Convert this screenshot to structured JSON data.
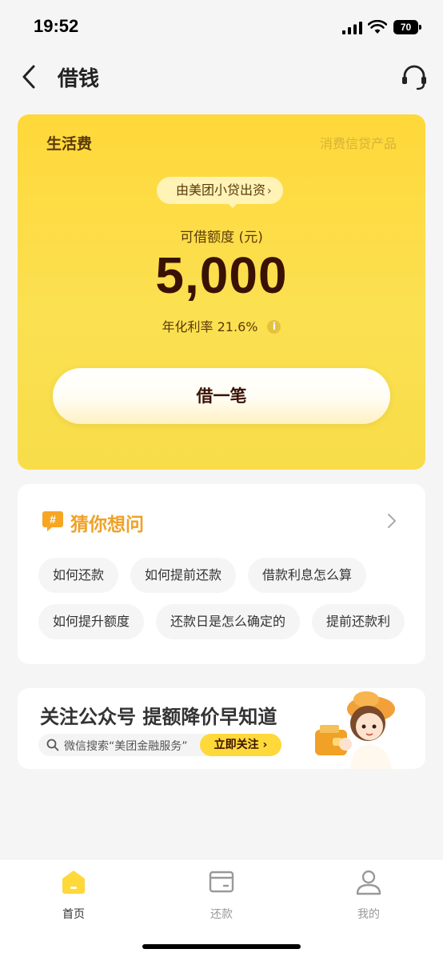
{
  "status_bar": {
    "time": "19:52",
    "battery": "70"
  },
  "nav": {
    "title": "借钱",
    "back_icon": "chevron-left-icon",
    "service_icon": "headset-icon"
  },
  "loan_card": {
    "category": "生活费",
    "product_tag": "消费信贷产品",
    "lender": "由美团小贷出资",
    "limit_label": "可借额度 (元)",
    "limit_amount": "5,000",
    "rate_text": "年化利率 21.6%",
    "borrow_button": "借一笔",
    "colors": {
      "card": "#fbe051",
      "text_dark": "#3a1204"
    }
  },
  "faq": {
    "title": "猜你想问",
    "icon": "hash-chat-icon",
    "row1": [
      "如何还款",
      "如何提前还款",
      "借款利息怎么算"
    ],
    "row2": [
      "如何提升额度",
      "还款日是怎么确定的",
      "提前还款利"
    ]
  },
  "promo": {
    "title": "关注公众号 提额降价早知道",
    "search_text": "微信搜索“美团金融服务”",
    "follow_button": "立即关注 ›"
  },
  "tabbar": {
    "tabs": [
      {
        "label": "首页",
        "icon": "home-icon",
        "active": true
      },
      {
        "label": "还款",
        "icon": "repay-icon",
        "active": false
      },
      {
        "label": "我的",
        "icon": "user-icon",
        "active": false
      }
    ],
    "accent": "#ffd83a"
  }
}
